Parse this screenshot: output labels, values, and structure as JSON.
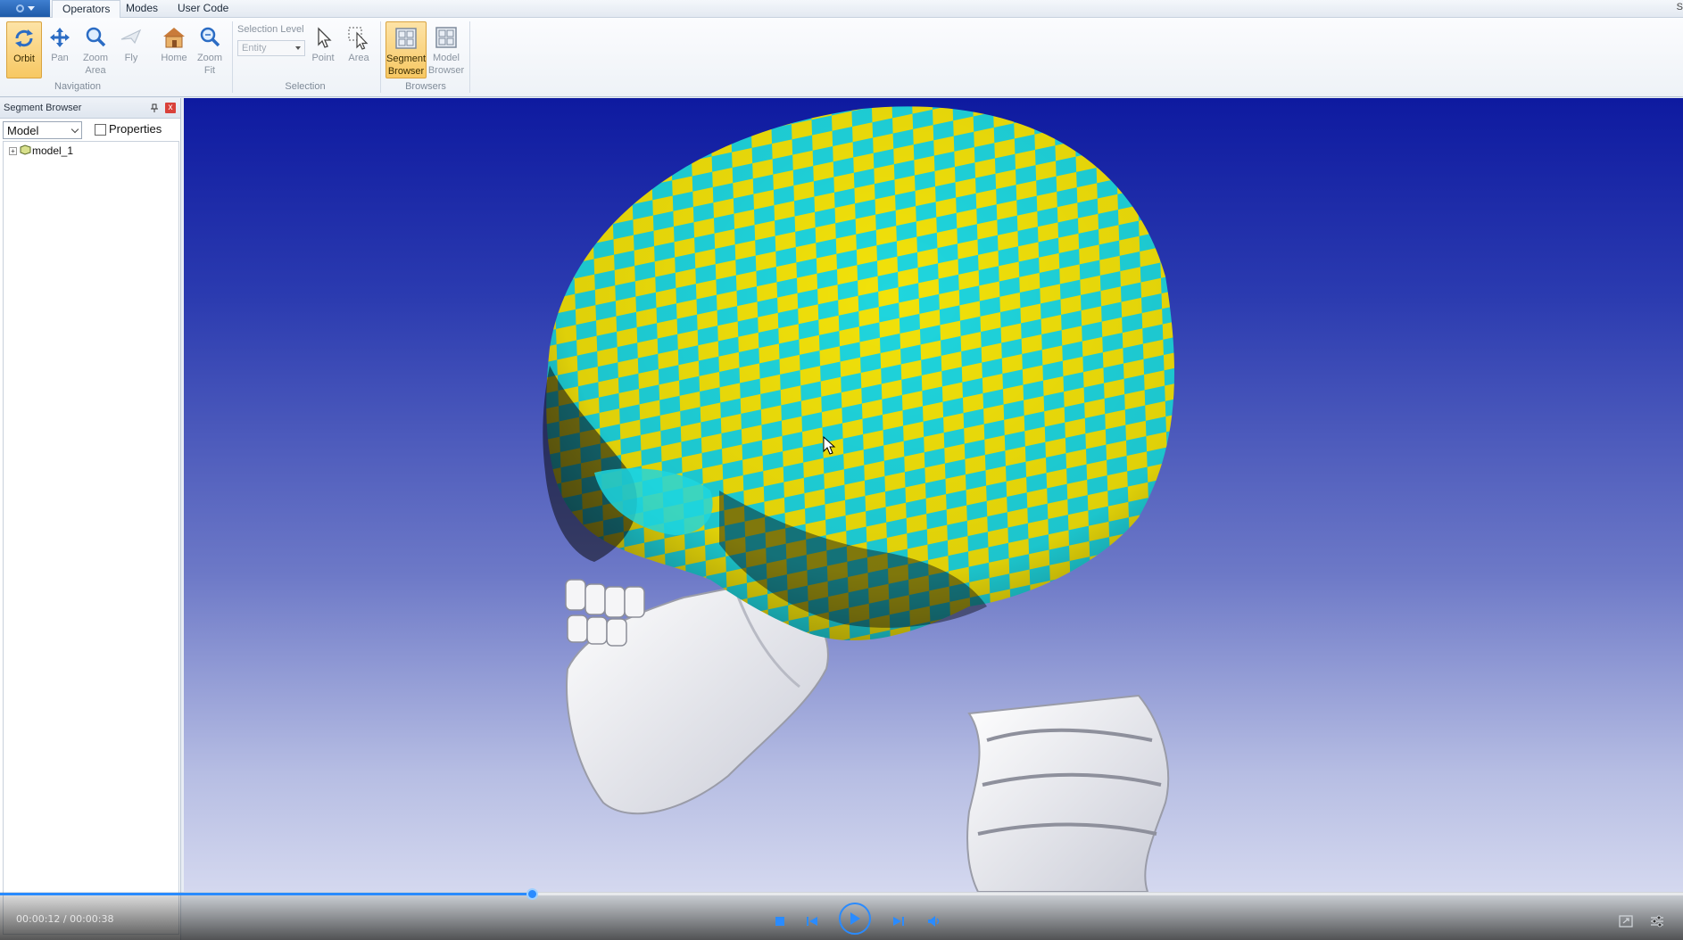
{
  "tabs": {
    "operators": "Operators",
    "modes": "Modes",
    "user_code": "User Code",
    "corner_text": "S"
  },
  "ribbon": {
    "navigation": {
      "group_label": "Navigation",
      "orbit": "Orbit",
      "pan": "Pan",
      "zoom_area": "Zoom\nArea",
      "fly": "Fly",
      "home": "Home",
      "zoom_fit": "Zoom\nFit"
    },
    "selection": {
      "group_label": "Selection",
      "level_label": "Selection Level",
      "level_value": "Entity",
      "point": "Point",
      "area": "Area"
    },
    "browsers": {
      "group_label": "Browsers",
      "segment_browser": "Segment\nBrowser",
      "model_browser": "Model\nBrowser"
    }
  },
  "left_panel": {
    "title": "Segment Browser",
    "close_glyph": "x",
    "combo_value": "Model",
    "properties_label": "Properties",
    "tree": [
      {
        "label": "model_1",
        "expander": "+"
      }
    ]
  },
  "video": {
    "time": "00:00:12 / 00:00:38",
    "progress": 0.3158
  },
  "colors": {
    "checker_yellow": "#f2e20a",
    "checker_cyan": "#1fd6de",
    "bone_white": "#eeeef2",
    "accent_blue": "#2a8bff",
    "ribbon_active": "#f7c863"
  }
}
